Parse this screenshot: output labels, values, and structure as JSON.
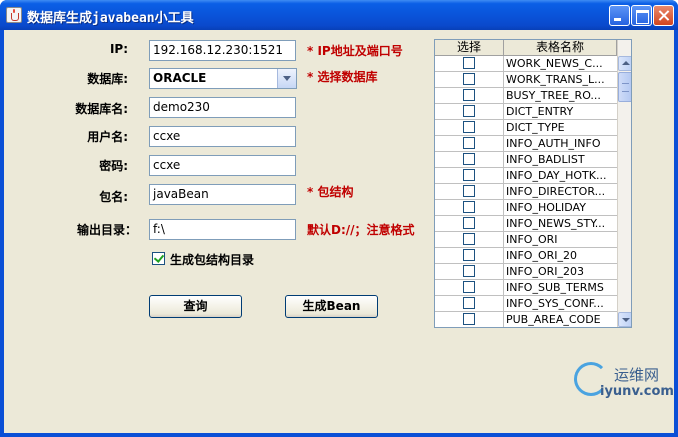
{
  "window": {
    "title": "数据库生成javabean小工具"
  },
  "form": {
    "ip": {
      "label": "IP:",
      "value": "192.168.12.230:1521",
      "hint": "* IP地址及端口号"
    },
    "db": {
      "label": "数据库:",
      "value": "ORACLE",
      "hint": "* 选择数据库"
    },
    "dbname": {
      "label": "数据库名:",
      "value": "demo230"
    },
    "user": {
      "label": "用户名:",
      "value": "ccxe"
    },
    "password": {
      "label": "密码:",
      "value": "ccxe"
    },
    "package": {
      "label": "包名:",
      "value": "javaBean",
      "hint": "* 包结构"
    },
    "output": {
      "label": "输出目录：",
      "value": "f:\\",
      "hint": "默认D://；注意格式"
    },
    "gen_dirs": {
      "label": "生成包结构目录",
      "checked": true
    },
    "query_button": "查询",
    "generate_button": "生成Bean"
  },
  "table": {
    "headers": [
      "选择",
      "表格名称"
    ],
    "rows": [
      "WORK_NEWS_C...",
      "WORK_TRANS_L...",
      "BUSY_TREE_RO...",
      "DICT_ENTRY",
      "DICT_TYPE",
      "INFO_AUTH_INFO",
      "INFO_BADLIST",
      "INFO_DAY_HOTK...",
      "INFO_DIRECTOR...",
      "INFO_HOLIDAY",
      "INFO_NEWS_STY...",
      "INFO_ORI",
      "INFO_ORI_20",
      "INFO_ORI_203",
      "INFO_SUB_TERMS",
      "INFO_SYS_CONF...",
      "PUB_AREA_CODE"
    ]
  },
  "watermark": {
    "cn": "运维网",
    "en": "iyunv.com"
  },
  "colors": {
    "hint_red": "#c00000",
    "title_blue": "#0a52d8",
    "panel": "#ece9d8"
  }
}
